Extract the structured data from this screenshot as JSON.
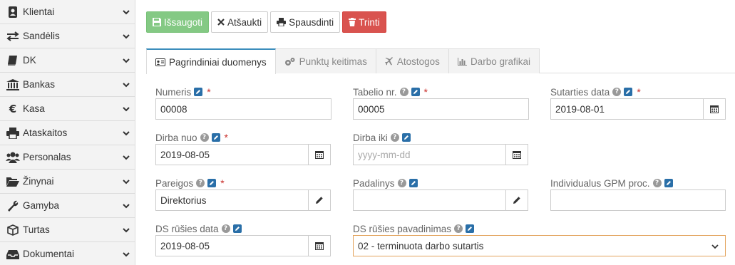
{
  "sidebar": {
    "items": [
      {
        "label": "Klientai",
        "icon": "address-book-icon"
      },
      {
        "label": "Sandėlis",
        "icon": "exchange-arrows-icon"
      },
      {
        "label": "DK",
        "icon": "book-icon"
      },
      {
        "label": "Bankas",
        "icon": "bank-icon"
      },
      {
        "label": "Kasa",
        "icon": "euro-icon"
      },
      {
        "label": "Ataskaitos",
        "icon": "printer-icon"
      },
      {
        "label": "Personalas",
        "icon": "users-icon"
      },
      {
        "label": "Žinynai",
        "icon": "folder-open-icon"
      },
      {
        "label": "Gamyba",
        "icon": "wrench-icon"
      },
      {
        "label": "Turtas",
        "icon": "cube-icon"
      },
      {
        "label": "Dokumentai",
        "icon": "inbox-icon"
      }
    ]
  },
  "toolbar": {
    "save_label": "Išsaugoti",
    "cancel_label": "Atšaukti",
    "print_label": "Spausdinti",
    "delete_label": "Trinti"
  },
  "tabs": [
    {
      "label": "Pagrindiniai duomenys",
      "active": true
    },
    {
      "label": "Punktų keitimas",
      "active": false
    },
    {
      "label": "Atostogos",
      "active": false
    },
    {
      "label": "Darbo grafikai",
      "active": false
    }
  ],
  "form": {
    "numeris": {
      "label": "Numeris",
      "value": "00008"
    },
    "tabelio_nr": {
      "label": "Tabelio nr.",
      "value": "00005"
    },
    "sutarties_data": {
      "label": "Sutarties data",
      "value": "2019-08-01"
    },
    "dirba_nuo": {
      "label": "Dirba nuo",
      "value": "2019-08-05"
    },
    "dirba_iki": {
      "label": "Dirba iki",
      "placeholder": "yyyy-mm-dd"
    },
    "pareigos": {
      "label": "Pareigos",
      "value": "Direktorius"
    },
    "padalinys": {
      "label": "Padalinys",
      "value": ""
    },
    "gpm": {
      "label": "Individualus GPM proc.",
      "value": ""
    },
    "ds_rusies_data": {
      "label": "DS rūšies data",
      "value": "2019-08-05"
    },
    "ds_rusies_pavadinimas": {
      "label": "DS rūšies pavadinimas",
      "value": "02 - terminuota darbo sutartis"
    }
  },
  "required_marker": "*",
  "colors": {
    "save": "#5cb85c",
    "delete": "#d9534f",
    "tab_accent": "#3c8dbc",
    "edit_badge": "#2a6fa8",
    "required": "#c9302c"
  }
}
